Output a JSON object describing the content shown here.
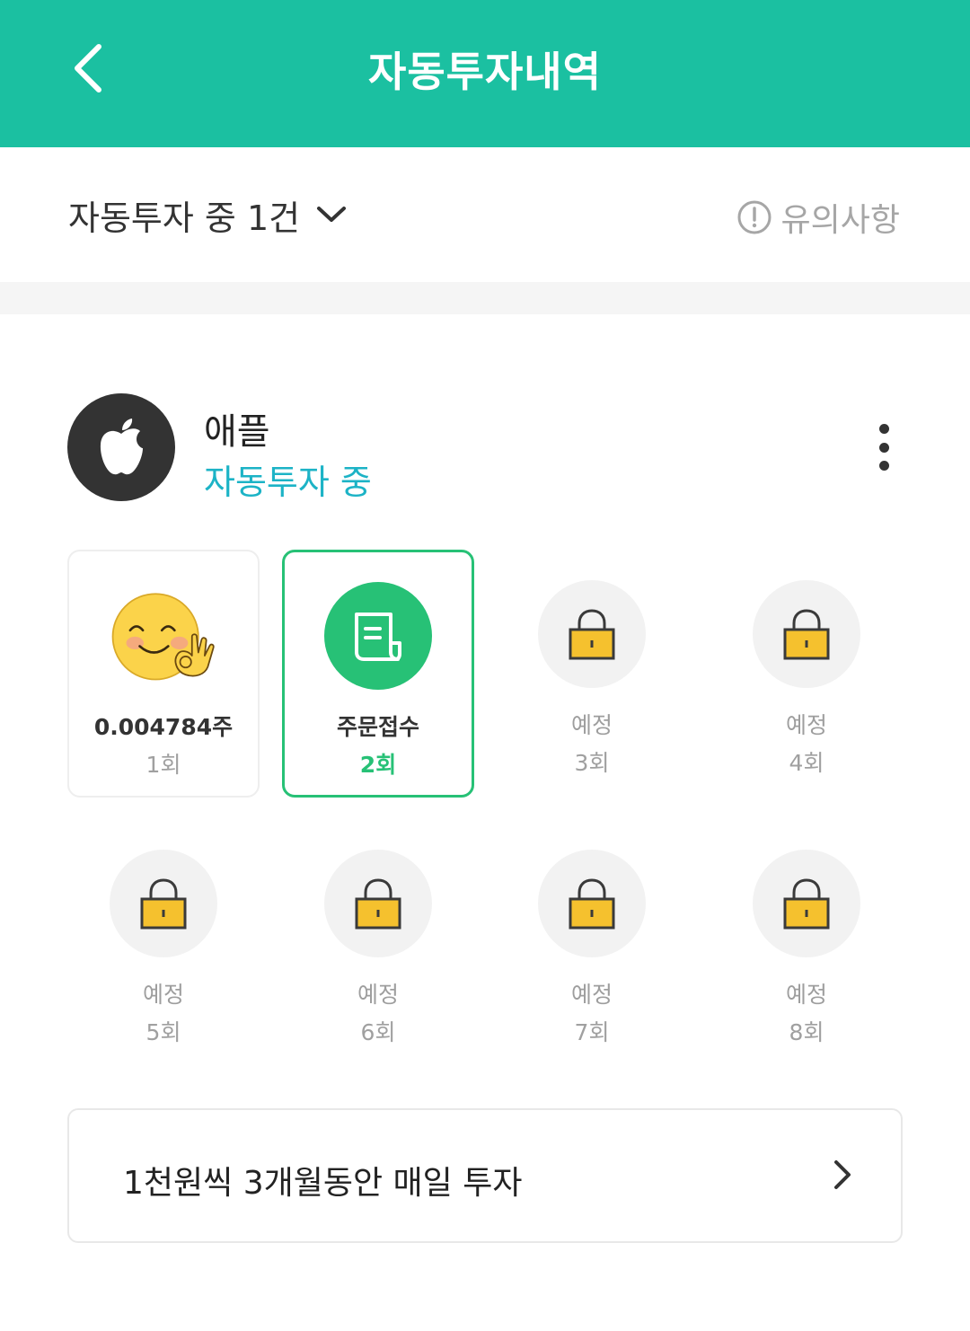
{
  "header": {
    "title": "자동투자내역",
    "back_icon": "chevron-left-icon",
    "background": "#1bc0a1"
  },
  "filter": {
    "label": "자동투자 중 1건",
    "dropdown_icon": "chevron-down-icon"
  },
  "notice": {
    "label": "유의사항",
    "icon": "info-circle-icon"
  },
  "stock": {
    "name": "애플",
    "status": "자동투자 중",
    "status_color": "#1cb3c6",
    "logo_icon": "apple-logo-icon",
    "menu_icon": "more-vertical-icon"
  },
  "rounds": [
    {
      "main": "0.004784주",
      "num": "1회",
      "state": "completed",
      "icon": "smile-ok-emoji-icon"
    },
    {
      "main": "주문접수",
      "num": "2회",
      "state": "order-received",
      "icon": "receipt-icon"
    },
    {
      "main": "예정",
      "num": "3회",
      "state": "scheduled",
      "icon": "lock-icon"
    },
    {
      "main": "예정",
      "num": "4회",
      "state": "scheduled",
      "icon": "lock-icon"
    },
    {
      "main": "예정",
      "num": "5회",
      "state": "scheduled",
      "icon": "lock-icon"
    },
    {
      "main": "예정",
      "num": "6회",
      "state": "scheduled",
      "icon": "lock-icon"
    },
    {
      "main": "예정",
      "num": "7회",
      "state": "scheduled",
      "icon": "lock-icon"
    },
    {
      "main": "예정",
      "num": "8회",
      "state": "scheduled",
      "icon": "lock-icon"
    }
  ],
  "plan": {
    "label": "1천원씩 3개월동안 매일 투자",
    "icon": "chevron-right-icon"
  },
  "colors": {
    "accent_green": "#27c176",
    "lock_yellow": "#f5c12e"
  }
}
